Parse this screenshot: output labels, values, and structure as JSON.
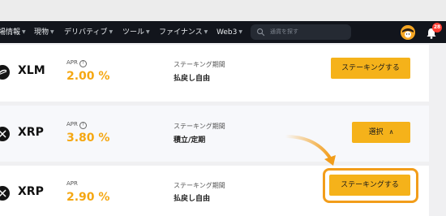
{
  "nav": {
    "items": [
      {
        "label": "場情報",
        "has_caret": true
      },
      {
        "label": "現物",
        "has_caret": true
      },
      {
        "label": "デリバティブ",
        "has_caret": true
      },
      {
        "label": "ツール",
        "has_caret": true
      },
      {
        "label": "ファイナンス",
        "has_caret": true
      },
      {
        "label": "Web3",
        "has_caret": true
      }
    ],
    "search_placeholder": "通貨を探す",
    "notification_count": "28"
  },
  "rows": [
    {
      "coin": "XLM",
      "apr_label": "APR",
      "apr_value": "2.00 %",
      "period_label": "ステーキング期間",
      "period_value": "払戻し自由",
      "button_label": "ステーキングする"
    },
    {
      "coin": "XRP",
      "apr_label": "APR",
      "apr_value": "3.80 %",
      "period_label": "ステーキング期間",
      "period_value": "積立/定期",
      "button_label": "選択",
      "button_icon": "chevron-up-icon"
    },
    {
      "coin": "XRP",
      "apr_label": "APR",
      "apr_value": "2.90 %",
      "period_label": "ステーキング期間",
      "period_value": "払戻し自由",
      "button_label": "ステーキングする"
    }
  ],
  "colors": {
    "accent": "#f5b21a",
    "apr": "#f5a712",
    "highlight": "#f29d1a",
    "navbar": "#12151c"
  }
}
